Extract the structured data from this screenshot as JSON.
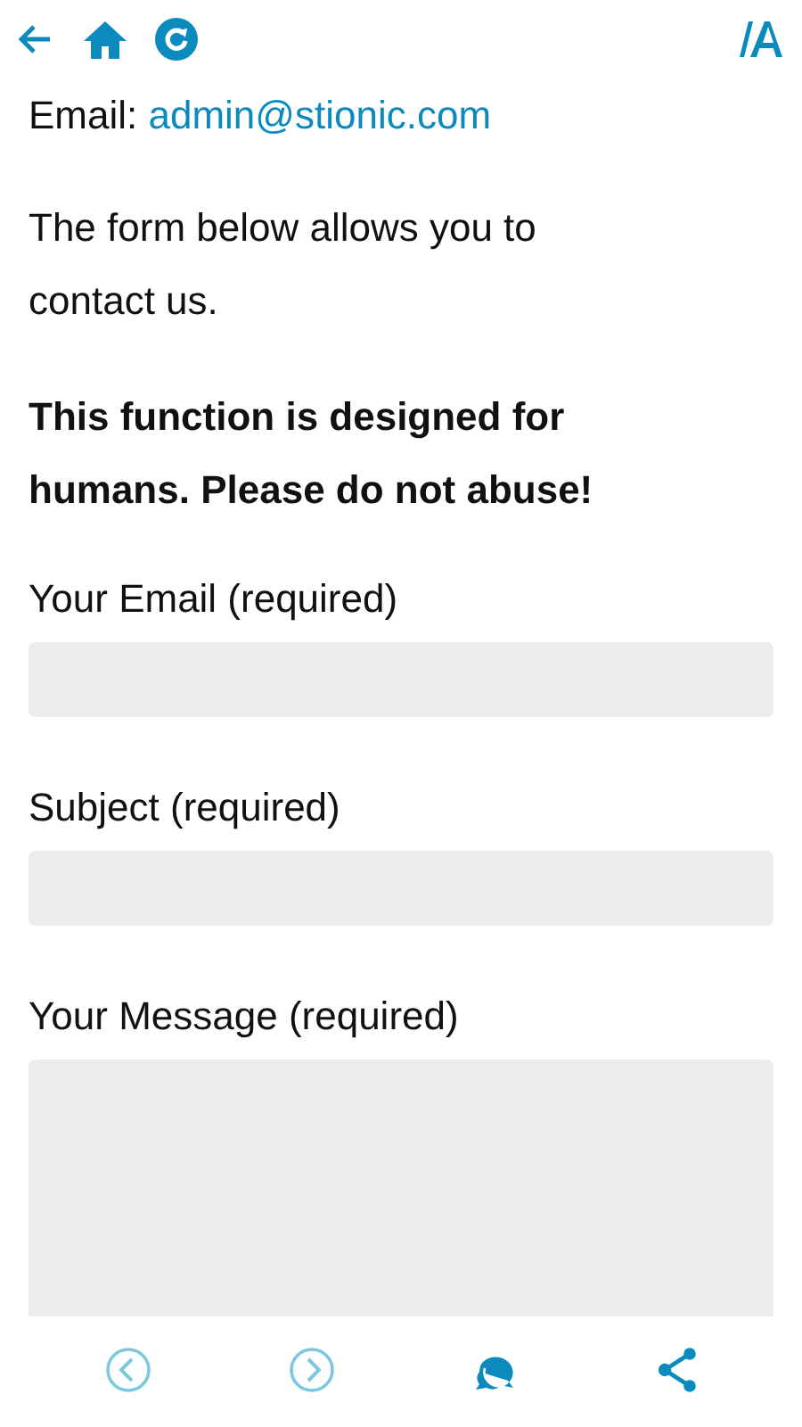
{
  "toolbar": {
    "buttons": [
      {
        "kind": "back"
      },
      {
        "kind": "home"
      },
      {
        "kind": "refresh"
      },
      {
        "kind": "font"
      }
    ]
  },
  "content": {
    "email_label": "Email:",
    "email_link": "admin@stionic.com",
    "intro": "The form below allows you to contact us.",
    "warning": "This function is designed for humans. Please do not abuse!",
    "fields": [
      {
        "label": "Your Email (required)",
        "kind": "input"
      },
      {
        "label": "Subject (required)",
        "kind": "input"
      },
      {
        "label": "Your Message (required)",
        "kind": "textarea"
      }
    ]
  },
  "bottom_bar": {
    "buttons": [
      {
        "kind": "previous",
        "disabled": true
      },
      {
        "kind": "next",
        "disabled": true
      },
      {
        "kind": "comments",
        "disabled": false
      },
      {
        "kind": "share",
        "disabled": false
      }
    ]
  }
}
